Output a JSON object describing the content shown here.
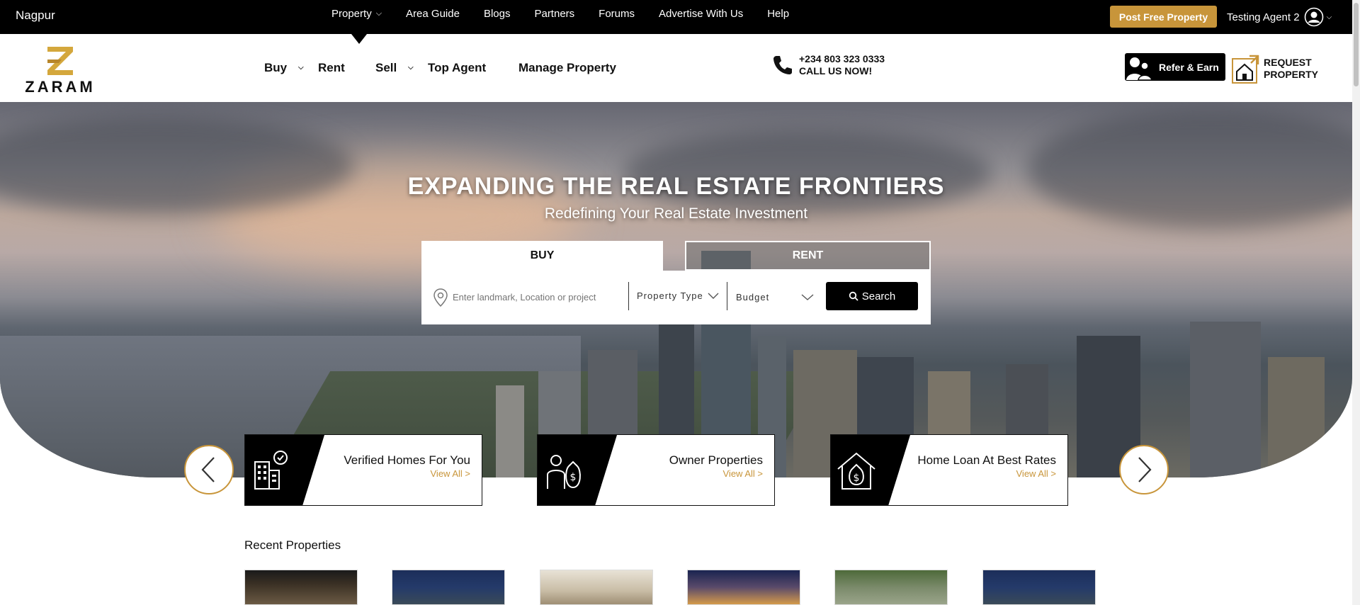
{
  "topbar": {
    "city": "Nagpur",
    "nav": [
      "Property",
      "Area Guide",
      "Blogs",
      "Partners",
      "Forums",
      "Advertise With Us",
      "Help"
    ],
    "post_button": "Post Free Property",
    "agent_name": "Testing Agent 2"
  },
  "header": {
    "logo_text": "ZARAM",
    "nav": {
      "buy": "Buy",
      "rent": "Rent",
      "sell": "Sell",
      "top_agent": "Top Agent",
      "manage": "Manage Property"
    },
    "phone_number": "+234 803 323 0333",
    "phone_cta": "CALL US NOW!",
    "refer": "Refer & Earn",
    "request_line1": "REQUEST",
    "request_line2": "PROPERTY"
  },
  "hero": {
    "title": "EXPANDING THE REAL ESTATE FRONTIERS",
    "subtitle": "Redefining Your Real Estate Investment",
    "tabs": {
      "buy": "BUY",
      "rent": "RENT"
    },
    "location_placeholder": "Enter landmark, Location or project",
    "property_type": "Property Type",
    "budget": "Budget",
    "search_button": "Search"
  },
  "features": [
    {
      "title": "Verified Homes For You",
      "link": "View All >"
    },
    {
      "title": "Owner Properties",
      "link": "View All >"
    },
    {
      "title": "Home Loan At Best Rates",
      "link": "View All >"
    }
  ],
  "recent": {
    "title": "Recent Properties"
  },
  "colors": {
    "accent": "#c8953a",
    "dark": "#000000"
  },
  "icons": [
    "chevron-down-icon",
    "user-avatar-icon",
    "phone-icon",
    "refer-icon",
    "request-property-icon",
    "location-pin-icon",
    "search-icon",
    "arrow-left-icon",
    "arrow-right-icon",
    "building-verified-icon",
    "owner-money-icon",
    "home-loan-icon"
  ]
}
